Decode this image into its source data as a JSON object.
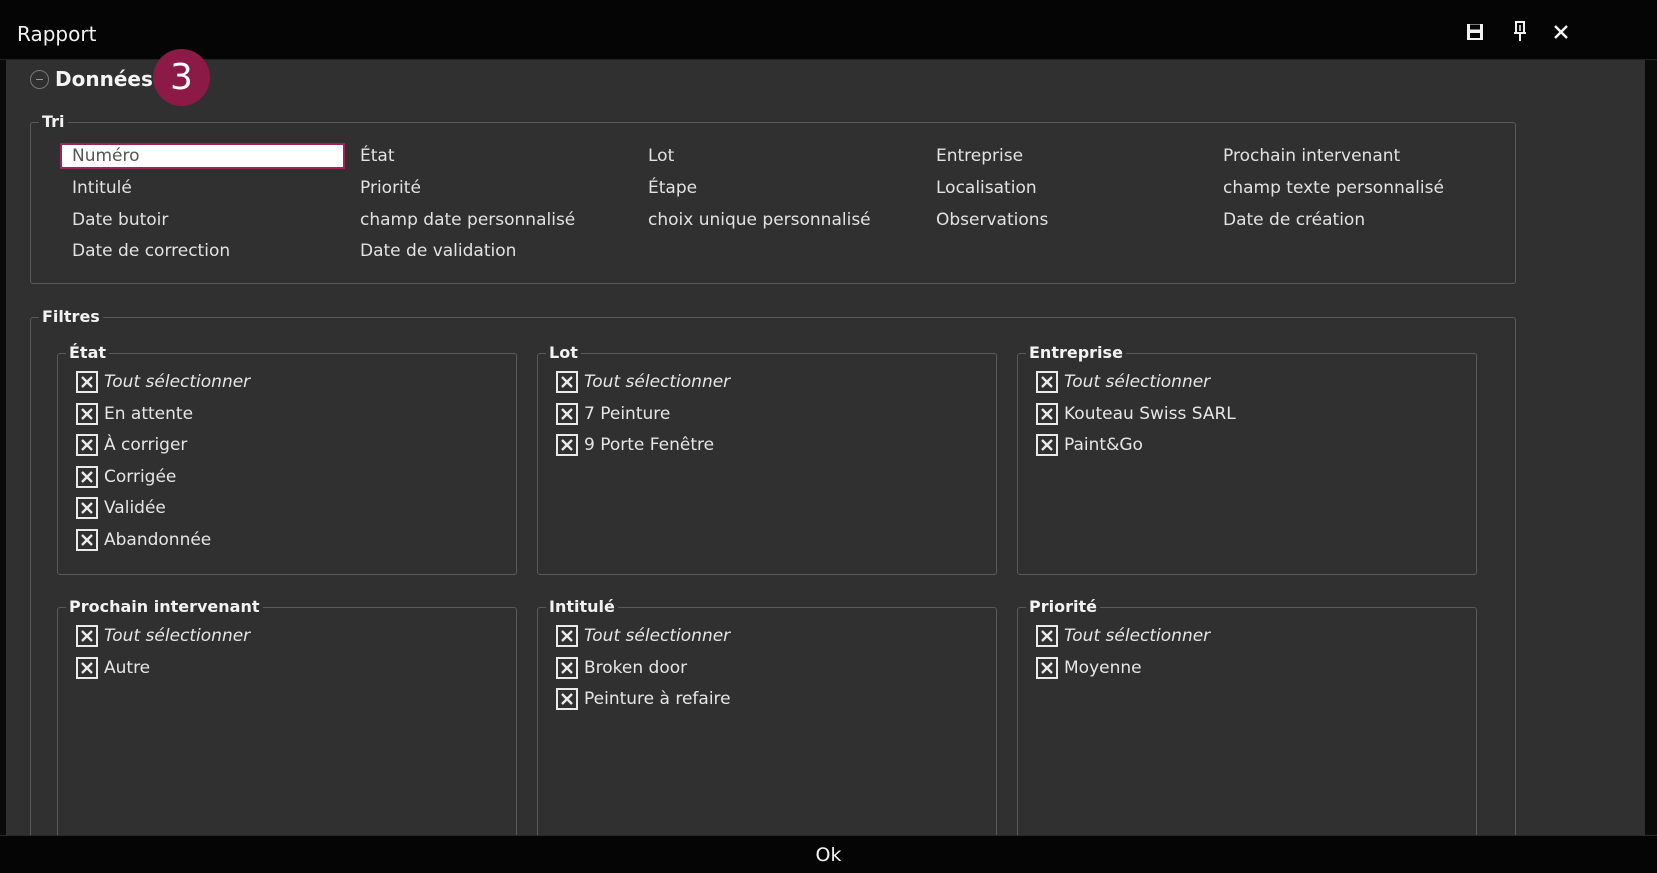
{
  "window": {
    "title": "Rapport",
    "icons": [
      "save-icon",
      "pin-icon",
      "close-icon"
    ]
  },
  "section": {
    "title": "Données",
    "badge": "3"
  },
  "sort": {
    "legend": "Tri",
    "selected": "Numéro",
    "items": [
      "Numéro",
      "État",
      "Lot",
      "Entreprise",
      "Prochain intervenant",
      "Intitulé",
      "Priorité",
      "Étape",
      "Localisation",
      "champ texte personnalisé",
      "Date butoir",
      "champ date personnalisé",
      "choix unique personnalisé",
      "Observations",
      "Date de création",
      "Date de correction",
      "Date de validation"
    ]
  },
  "filters": {
    "legend": "Filtres",
    "groups": [
      {
        "title": "État",
        "options": [
          {
            "label": "Tout sélectionner",
            "checked": true,
            "italic": true
          },
          {
            "label": "En attente",
            "checked": true
          },
          {
            "label": "À corriger",
            "checked": true
          },
          {
            "label": "Corrigée",
            "checked": true
          },
          {
            "label": "Validée",
            "checked": true
          },
          {
            "label": "Abandonnée",
            "checked": true
          }
        ]
      },
      {
        "title": "Lot",
        "options": [
          {
            "label": "Tout sélectionner",
            "checked": true,
            "italic": true
          },
          {
            "label": "7 Peinture",
            "checked": true
          },
          {
            "label": "9 Porte Fenêtre",
            "checked": true
          }
        ]
      },
      {
        "title": "Entreprise",
        "options": [
          {
            "label": "Tout sélectionner",
            "checked": true,
            "italic": true
          },
          {
            "label": "Kouteau Swiss SARL",
            "checked": true
          },
          {
            "label": "Paint&Go",
            "checked": true
          }
        ]
      },
      {
        "title": "Prochain intervenant",
        "options": [
          {
            "label": "Tout sélectionner",
            "checked": true,
            "italic": true
          },
          {
            "label": "Autre",
            "checked": true
          }
        ]
      },
      {
        "title": "Intitulé",
        "options": [
          {
            "label": "Tout sélectionner",
            "checked": true,
            "italic": true
          },
          {
            "label": "Broken door",
            "checked": true
          },
          {
            "label": "Peinture à refaire",
            "checked": true
          }
        ]
      },
      {
        "title": "Priorité",
        "options": [
          {
            "label": "Tout sélectionner",
            "checked": true,
            "italic": true
          },
          {
            "label": "Moyenne",
            "checked": true
          }
        ]
      }
    ]
  },
  "footer": {
    "ok_label": "Ok"
  },
  "colors": {
    "accent": "#a0245a",
    "badge": "#8b1a46",
    "background": "#303030",
    "titlebar": "#050505"
  }
}
